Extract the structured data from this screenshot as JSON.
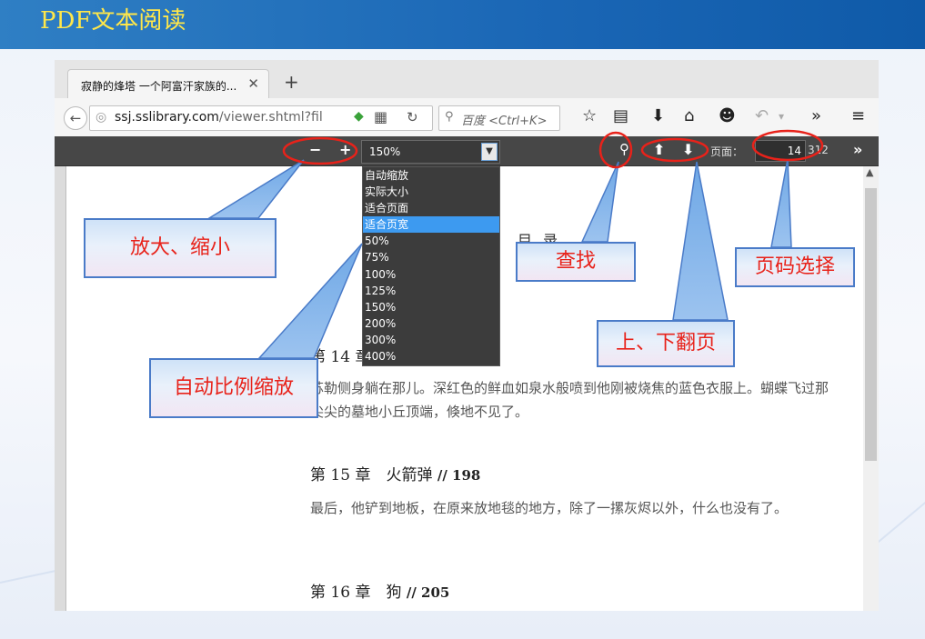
{
  "slide": {
    "title": "PDF文本阅读"
  },
  "browser": {
    "tab_title": "寂静的烽塔 一个阿富汗家族的...",
    "tab_close": "✕",
    "new_tab": "+",
    "url_host": "ssj.sslibrary.com",
    "url_path": "/viewer.shtml?fil",
    "search_placeholder": "百度 <Ctrl+K>"
  },
  "pdf_toolbar": {
    "zoom_out": "−",
    "zoom_in": "+",
    "zoom_value": "150%",
    "page_label": "页面：",
    "current_page": "14",
    "total_pages": "312",
    "more": "»"
  },
  "zoom_options": [
    "自动缩放",
    "实际大小",
    "适合页面",
    "适合页宽",
    "50%",
    "75%",
    "100%",
    "125%",
    "150%",
    "200%",
    "300%",
    "400%"
  ],
  "zoom_selected": "适合页宽",
  "document": {
    "toc_title": "目录",
    "chapter14_head": "第 14 章",
    "chapter14_text": "苏勒侧身躺在那儿。深红色的鲜血如泉水般喷到他刚被烧焦的蓝色衣服上。蝴蝶飞过那尖尖的墓地小丘顶端，倏地不见了。",
    "chapter15_head": "第 15 章　火箭弹",
    "chapter15_page": "// 198",
    "chapter15_text": "最后，他铲到地板，在原来放地毯的地方，除了一摞灰烬以外，什么也没有了。",
    "chapter16_head": "第 16 章　狗",
    "chapter16_page": "// 205"
  },
  "annotations": {
    "zoom": "放大、缩小",
    "auto_zoom": "自动比例缩放",
    "find": "查找",
    "page_select": "页码选择",
    "page_turn": "上、下翻页"
  },
  "colors": {
    "header_blue": "#1a66b5",
    "title_yellow": "#ffe74a",
    "annotation_red": "#e8221a",
    "callout_border": "#4a7bc8"
  }
}
